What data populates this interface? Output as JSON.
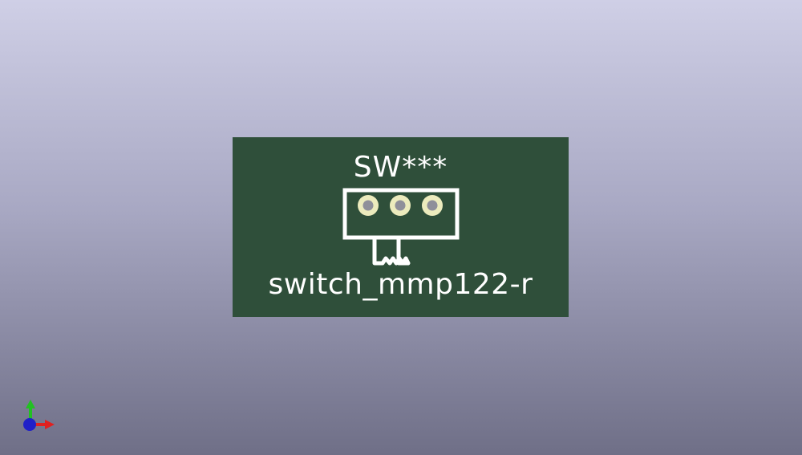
{
  "board": {
    "reference": "SW***",
    "value": "switch_mmp122-r"
  },
  "colors": {
    "board_fill": "#2f4f3a",
    "silkscreen": "#ffffff",
    "pad_ring": "#ecebbd",
    "pad_hole": "#8f8f9a",
    "axis_x": "#e02020",
    "axis_y": "#22c022",
    "axis_z": "#2020c8"
  },
  "icons": {
    "pad": "through-hole-pad-icon",
    "axis": "3d-axis-gizmo-icon"
  }
}
